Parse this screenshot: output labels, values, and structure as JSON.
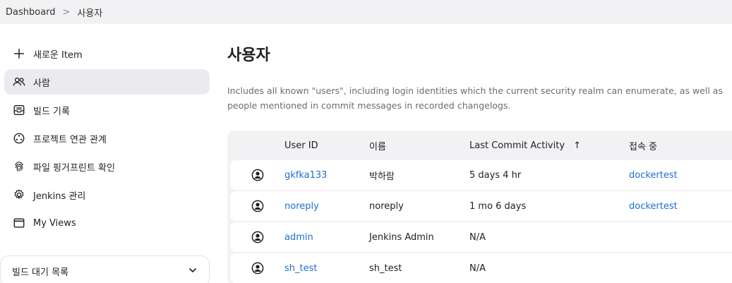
{
  "breadcrumb": {
    "items": [
      "Dashboard",
      "사용자"
    ],
    "separator": ">"
  },
  "sidebar": {
    "items": [
      {
        "label": "새로운 Item",
        "icon": "plus-icon"
      },
      {
        "label": "사람",
        "icon": "people-icon"
      },
      {
        "label": "빌드 기록",
        "icon": "inbox-icon"
      },
      {
        "label": "프로젝트 연관 관계",
        "icon": "relationship-icon"
      },
      {
        "label": "파일 핑거프린트 확인",
        "icon": "fingerprint-icon"
      },
      {
        "label": "Jenkins 관리",
        "icon": "gear-icon"
      },
      {
        "label": "My Views",
        "icon": "window-icon"
      }
    ],
    "active_index": 1
  },
  "build_queue": {
    "label": "빌드 대기 목록",
    "icon": "chevron-down-icon"
  },
  "main": {
    "title": "사용자",
    "description": "Includes all known \"users\", including login identities which the current security realm can enumerate, as well as people mentioned in commit messages in recorded changelogs."
  },
  "table": {
    "headers": {
      "user_id": "User ID",
      "name": "이름",
      "last_commit": "Last Commit Activity",
      "sort_indicator": "↑",
      "online": "접속 중"
    },
    "rows": [
      {
        "user_id": "gkfka133",
        "name": "박하람",
        "last_commit": "5 days 4 hr",
        "online": "dockertest"
      },
      {
        "user_id": "noreply",
        "name": "noreply",
        "last_commit": "1 mo 6 days",
        "online": "dockertest"
      },
      {
        "user_id": "admin",
        "name": "Jenkins Admin",
        "last_commit": "N/A",
        "online": ""
      },
      {
        "user_id": "sh_test",
        "name": "sh_test",
        "last_commit": "N/A",
        "online": ""
      }
    ]
  },
  "colors": {
    "accent_link": "#1f6fd1",
    "active_bg": "#ebebef",
    "topbar_bg": "#f2f2f4"
  }
}
